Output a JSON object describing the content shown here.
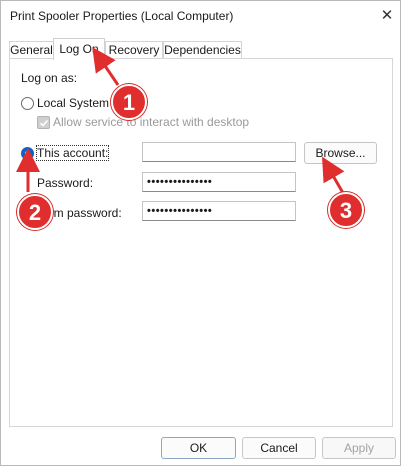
{
  "window": {
    "title": "Print Spooler Properties (Local Computer)",
    "close_glyph": "✕"
  },
  "tabs": [
    {
      "label": "General"
    },
    {
      "label": "Log On",
      "active": true
    },
    {
      "label": "Recovery"
    },
    {
      "label": "Dependencies"
    }
  ],
  "logon": {
    "log_on_as_label": "Log on as:",
    "local_system_label": "Local System ac",
    "allow_interact_label": "Allow service to interact with desktop",
    "allow_interact_checked": true,
    "allow_interact_disabled": true,
    "this_account_label": "This account:",
    "this_account_selected": true,
    "account_value": "",
    "password_label": "Password:",
    "password_value": "•••••••••••••••",
    "confirm_label": "nfirm password:",
    "confirm_value": "•••••••••••••••",
    "browse_label": "Browse..."
  },
  "footer": {
    "ok_label": "OK",
    "cancel_label": "Cancel",
    "apply_label": "Apply",
    "apply_disabled": true
  },
  "annotations": {
    "color": "#e02d2d",
    "markers": [
      "1",
      "2",
      "3"
    ]
  }
}
